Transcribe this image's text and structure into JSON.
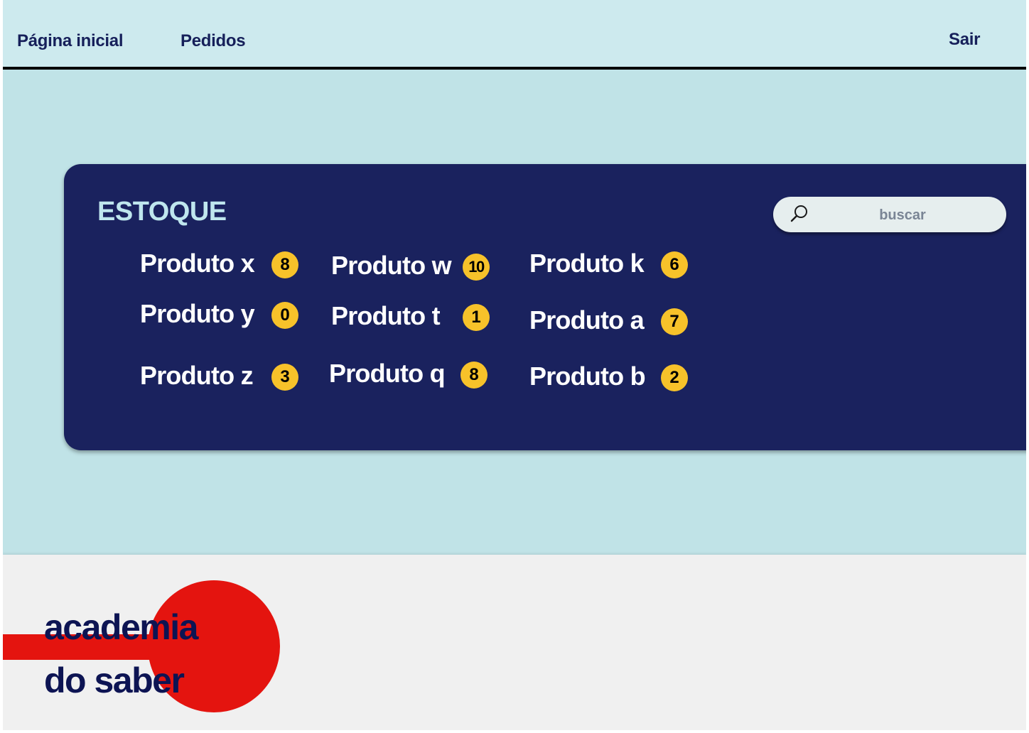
{
  "nav": {
    "home_label": "Página inicial",
    "orders_label": "Pedidos",
    "exit_label": "Sair"
  },
  "stock": {
    "title": "ESTOQUE",
    "search_placeholder": "buscar",
    "products": [
      {
        "label": "Produto x",
        "count": "8"
      },
      {
        "label": "Produto y",
        "count": "0"
      },
      {
        "label": "Produto z",
        "count": "3"
      },
      {
        "label": "Produto w",
        "count": "10"
      },
      {
        "label": "Produto t",
        "count": "1"
      },
      {
        "label": "Produto q",
        "count": "8"
      },
      {
        "label": "Produto k",
        "count": "6"
      },
      {
        "label": "Produto a",
        "count": "7"
      },
      {
        "label": "Produto b",
        "count": "2"
      }
    ]
  },
  "footer": {
    "logo_line1": "academia",
    "logo_line2": "do saber"
  },
  "colors": {
    "background": "#c0e3e7",
    "navbar": "#cdeaee",
    "panel": "#1a225e",
    "badge": "#f7c22a",
    "logo_red": "#e4140f",
    "logo_text": "#0d1453"
  },
  "icons": {
    "search": "search-icon"
  }
}
